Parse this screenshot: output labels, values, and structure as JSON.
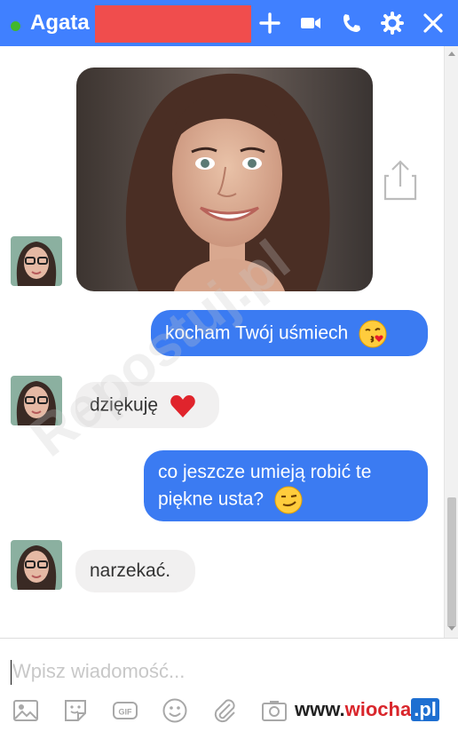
{
  "header": {
    "contact_name": "Agata",
    "status": "online",
    "icons": [
      "plus-icon",
      "video-camera-icon",
      "phone-icon",
      "gear-icon",
      "close-icon"
    ],
    "accent_color": "#4080ff"
  },
  "messages": [
    {
      "type": "image",
      "sender": "contact",
      "icon": "share-icon"
    },
    {
      "type": "text",
      "sender": "me",
      "text": "kocham Twój uśmiech",
      "emoji": "kissing-heart-emoji"
    },
    {
      "type": "text",
      "sender": "contact",
      "text": "dziękuję",
      "emoji": "red-heart-emoji"
    },
    {
      "type": "text",
      "sender": "me",
      "lines": [
        "co jeszcze umieją robić te",
        "piękne usta?"
      ],
      "emoji": "smirk-emoji"
    },
    {
      "type": "text",
      "sender": "contact",
      "text": "narzekać."
    }
  ],
  "composer": {
    "placeholder": "Wpisz wiadomość...",
    "tools": [
      "photo-icon",
      "sticker-icon",
      "gif-icon",
      "emoji-icon",
      "attachment-icon",
      "camera-icon"
    ]
  },
  "watermark": {
    "text": "Repostuj.pl"
  },
  "site_logo": {
    "prefix": "www.",
    "accent": "wiocha",
    "suffix": ".pl"
  },
  "colors": {
    "outgoing_bubble": "#3b7bf2",
    "incoming_bubble": "#f1f0f0",
    "online": "#42b72a",
    "redaction": "#f04d4d"
  }
}
